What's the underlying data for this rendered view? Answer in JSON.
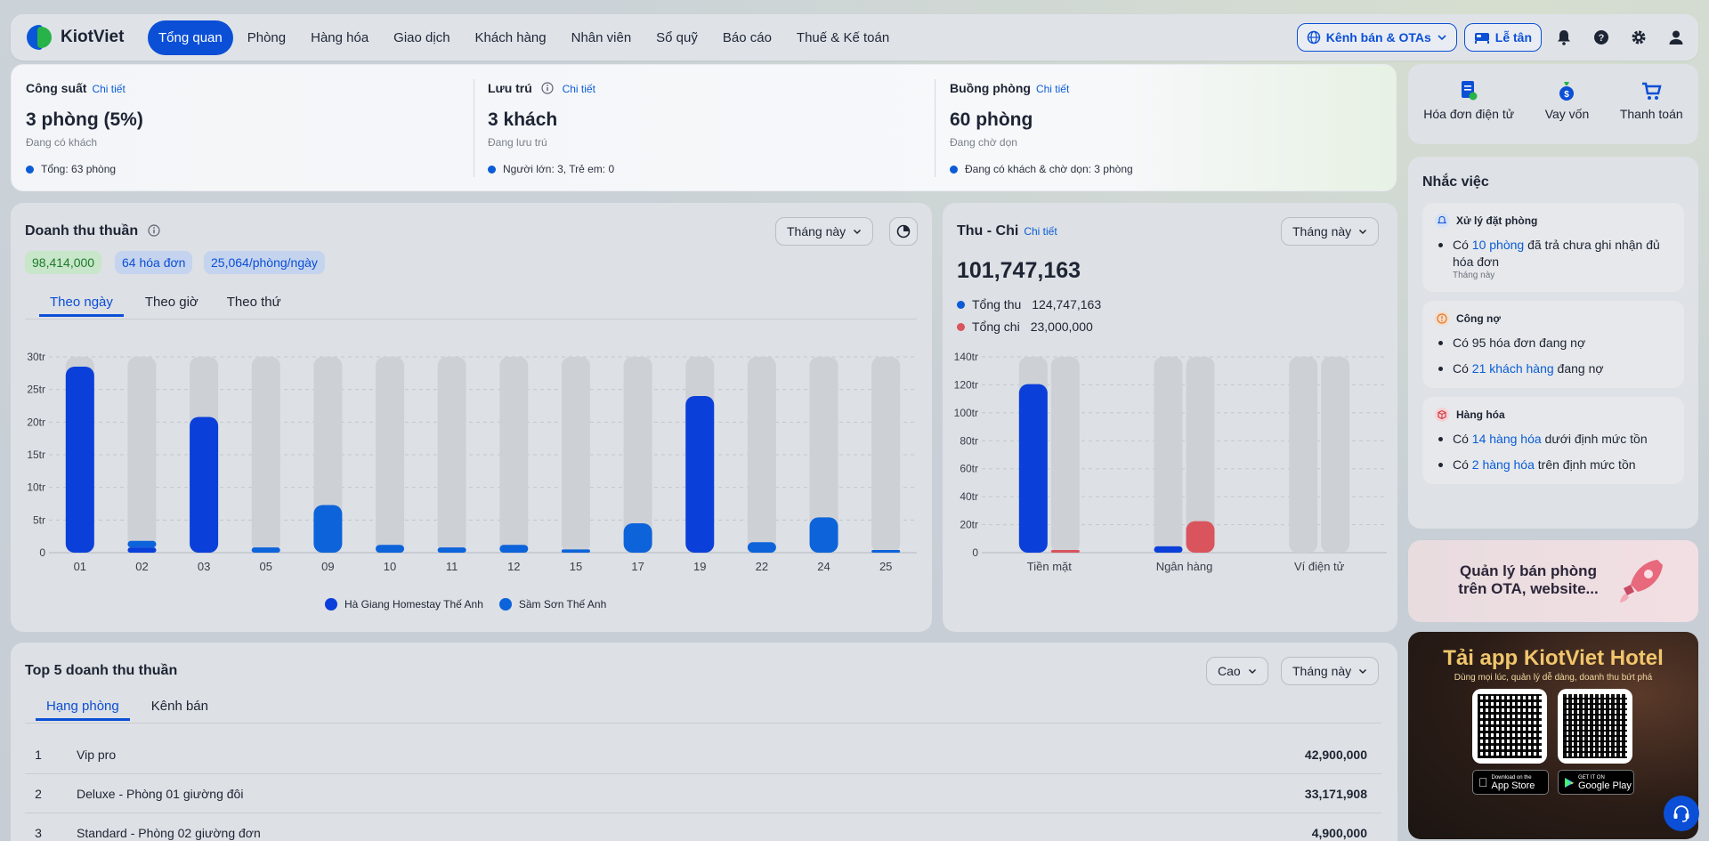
{
  "nav": {
    "brand": "KiotViet",
    "items": [
      "Tổng quan",
      "Phòng",
      "Hàng hóa",
      "Giao dịch",
      "Khách hàng",
      "Nhân viên",
      "Sổ quỹ",
      "Báo cáo",
      "Thuế & Kế toán"
    ],
    "active_index": 0,
    "channel_button": "Kênh bán & OTAs",
    "reception_button": "Lễ tân",
    "icons": [
      "bell-icon",
      "help-icon",
      "gear-icon",
      "user-icon"
    ]
  },
  "kpi": [
    {
      "title": "Công suất",
      "link": "Chi tiết",
      "value": "3 phòng (5%)",
      "sub": "Đang có khách",
      "foot": "Tổng: 63 phòng"
    },
    {
      "title": "Lưu trú",
      "link": "Chi tiết",
      "value": "3 khách",
      "sub": "Đang lưu trú",
      "foot": "Người lớn: 3,  Trẻ em: 0"
    },
    {
      "title": "Buồng phòng",
      "link": "Chi tiết",
      "value": "60 phòng",
      "sub": "Đang chờ dọn",
      "foot": "Đang có khách & chờ dọn: 3 phòng"
    }
  ],
  "revenue": {
    "title": "Doanh thu thuần",
    "period": "Tháng này",
    "chips": [
      "98,414,000",
      "64 hóa đơn",
      "25,064/phòng/ngày"
    ],
    "tabs": [
      "Theo ngày",
      "Theo giờ",
      "Theo thứ"
    ],
    "legend": [
      "Hà Giang Homestay Thế Anh",
      "Sầm Sơn Thế Anh"
    ]
  },
  "cashflow": {
    "title": "Thu - Chi",
    "link": "Chi tiết",
    "period": "Tháng này",
    "total": "101,747,163",
    "income_label": "Tổng thu",
    "income_value": "124,747,163",
    "expense_label": "Tổng chi",
    "expense_value": "23,000,000"
  },
  "chart_data": [
    {
      "type": "bar",
      "title": "Doanh thu thuần",
      "categories": [
        "01",
        "02",
        "03",
        "05",
        "09",
        "10",
        "11",
        "12",
        "15",
        "17",
        "19",
        "22",
        "24",
        "25"
      ],
      "y_ticks": [
        "0",
        "5tr",
        "10tr",
        "15tr",
        "20tr",
        "25tr",
        "30tr"
      ],
      "ylim": [
        0,
        30
      ],
      "series": [
        {
          "name": "Hà Giang Homestay Thế Anh",
          "color": "#0a3fd9",
          "values": [
            28.5,
            0.8,
            20.8,
            0,
            0,
            0,
            0,
            0,
            0,
            0,
            24,
            0,
            0,
            0
          ]
        },
        {
          "name": "Sầm Sơn Thế Anh",
          "color": "#0d63da",
          "values": [
            0,
            1,
            0,
            0.8,
            7.3,
            1.2,
            0.8,
            1.2,
            0.5,
            4.5,
            0,
            1.6,
            5.4,
            0.2
          ]
        }
      ],
      "legend": "bottom-center",
      "grid": true
    },
    {
      "type": "bar",
      "title": "Thu - Chi",
      "categories": [
        "Tiền mặt",
        "Ngân hàng",
        "Ví điện tử"
      ],
      "y_ticks": [
        "0",
        "20tr",
        "40tr",
        "60tr",
        "80tr",
        "100tr",
        "120tr",
        "140tr"
      ],
      "ylim": [
        0,
        140
      ],
      "series": [
        {
          "name": "Tổng thu",
          "color": "#0a3fd9",
          "values": [
            120.5,
            4.5,
            0
          ]
        },
        {
          "name": "Tổng chi",
          "color": "#d9545d",
          "values": [
            0.5,
            22.5,
            0
          ]
        }
      ],
      "grid": true
    }
  ],
  "top5": {
    "title": "Top 5 doanh thu thuần",
    "sort": "Cao",
    "period": "Tháng này",
    "tabs": [
      "Hạng phòng",
      "Kênh bán"
    ],
    "rows": [
      {
        "rank": "1",
        "name": "Vip pro",
        "value": "42,900,000"
      },
      {
        "rank": "2",
        "name": "Deluxe - Phòng 01 giường đôi",
        "value": "33,171,908"
      },
      {
        "rank": "3",
        "name": "Standard - Phòng 02 giường đơn",
        "value": "4,900,000"
      }
    ]
  },
  "quick": [
    "Hóa đơn điện tử",
    "Vay vốn",
    "Thanh toán"
  ],
  "reminders": {
    "title": "Nhắc việc",
    "booking": {
      "head": "Xử lý đặt phòng",
      "pre": "Có ",
      "link": "10 phòng",
      "post": " đã trả chưa ghi nhận đủ hóa đơn",
      "note": "Tháng này"
    },
    "debt": {
      "head": "Công nợ",
      "line1": "Có 95 hóa đơn đang nợ",
      "line2_pre": "Có ",
      "line2_link": "21 khách hàng",
      "line2_post": " đang nợ"
    },
    "goods": {
      "head": "Hàng hóa",
      "line1_pre": "Có ",
      "line1_link": "14 hàng hóa",
      "line1_post": " dưới định mức tồn",
      "line2_pre": "Có ",
      "line2_link": "2 hàng hóa",
      "line2_post": " trên định mức tồn"
    }
  },
  "promo": {
    "text": "Quản lý bán phòng trên OTA, website..."
  },
  "app": {
    "title": "Tải app KiotViet Hotel",
    "subtitle": "Dùng mọi lúc, quản lý dễ dàng, doanh thu bứt phá",
    "appstore_small": "Download on the",
    "appstore": "App Store",
    "gplay_small": "GET IT ON",
    "gplay": "Google Play"
  }
}
